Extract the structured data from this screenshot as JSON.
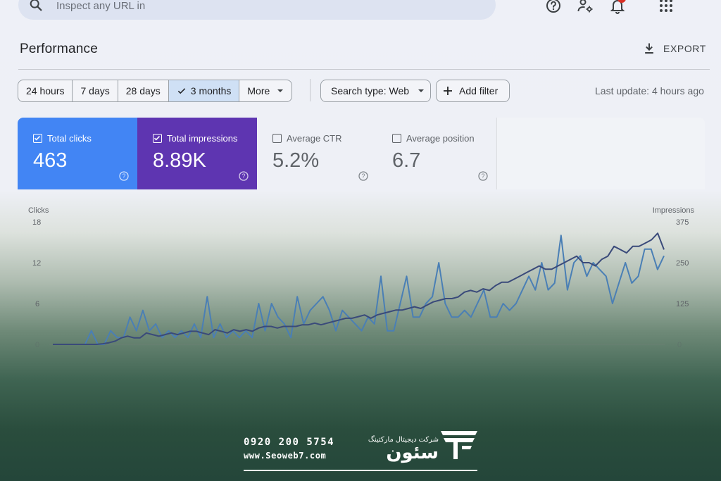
{
  "search": {
    "placeholder": "Inspect any URL in"
  },
  "header": {
    "title": "Performance",
    "export_label": "EXPORT"
  },
  "filters": {
    "ranges": [
      "24 hours",
      "7 days",
      "28 days",
      "3 months",
      "More"
    ],
    "active_range": "3 months",
    "search_type": "Search type: Web",
    "add_filter": "Add filter",
    "last_update": "Last update: 4 hours ago"
  },
  "metrics": [
    {
      "label": "Total clicks",
      "value": "463",
      "checked": true,
      "color": "#4285f4"
    },
    {
      "label": "Total impressions",
      "value": "8.89K",
      "checked": true,
      "color": "#5e35b1"
    },
    {
      "label": "Average CTR",
      "value": "5.2%",
      "checked": false
    },
    {
      "label": "Average position",
      "value": "6.7",
      "checked": false
    }
  ],
  "chart_data": {
    "type": "line",
    "left_axis": {
      "label": "Clicks",
      "ticks": [
        "18",
        "12",
        "6",
        "0"
      ],
      "range": [
        0,
        18
      ]
    },
    "right_axis": {
      "label": "Impressions",
      "ticks": [
        "375",
        "250",
        "125",
        "0"
      ],
      "range": [
        0,
        375
      ]
    },
    "series": [
      {
        "axis": "left",
        "color": "#4a7fb5",
        "values": [
          0,
          0,
          0,
          0,
          0,
          0,
          2,
          0,
          0,
          2,
          1,
          1,
          4,
          2,
          5,
          2,
          3,
          1,
          2,
          1,
          2,
          1,
          3,
          1,
          7,
          1,
          3,
          1,
          2,
          1,
          2,
          1,
          6,
          2,
          6,
          4,
          3,
          1,
          7,
          3,
          5,
          6,
          7,
          5,
          2,
          5,
          4,
          3,
          2,
          4,
          3,
          10,
          2,
          2,
          6,
          10,
          4,
          4,
          6,
          7,
          12,
          6,
          4,
          4,
          5,
          4,
          6,
          8,
          4,
          4,
          6,
          5,
          6,
          8,
          10,
          8,
          12,
          8,
          9,
          16,
          8,
          12,
          13,
          10,
          12,
          11,
          10,
          6,
          9,
          12,
          9,
          10,
          14,
          14,
          11,
          13
        ]
      },
      {
        "axis": "right",
        "color": "#3a4a7a",
        "values": [
          0,
          0,
          0,
          0,
          0,
          0,
          0,
          0,
          2,
          5,
          10,
          20,
          25,
          20,
          20,
          35,
          30,
          25,
          30,
          35,
          30,
          35,
          40,
          40,
          35,
          30,
          45,
          40,
          35,
          45,
          40,
          45,
          40,
          50,
          55,
          55,
          50,
          55,
          55,
          55,
          60,
          60,
          65,
          60,
          65,
          70,
          75,
          80,
          80,
          85,
          90,
          80,
          90,
          95,
          100,
          105,
          105,
          110,
          115,
          110,
          120,
          130,
          135,
          140,
          140,
          145,
          160,
          165,
          160,
          170,
          165,
          180,
          190,
          190,
          200,
          210,
          220,
          230,
          240,
          230,
          230,
          240,
          250,
          260,
          270,
          250,
          250,
          240,
          260,
          270,
          300,
          290,
          280,
          300,
          300,
          310,
          320,
          340,
          290
        ]
      }
    ]
  },
  "footer": {
    "phone": "0920 200 5754",
    "website": "www.Seoweb7.com",
    "company": "شرکت دیجیتال مارکتینگ",
    "brand": "سئون"
  }
}
